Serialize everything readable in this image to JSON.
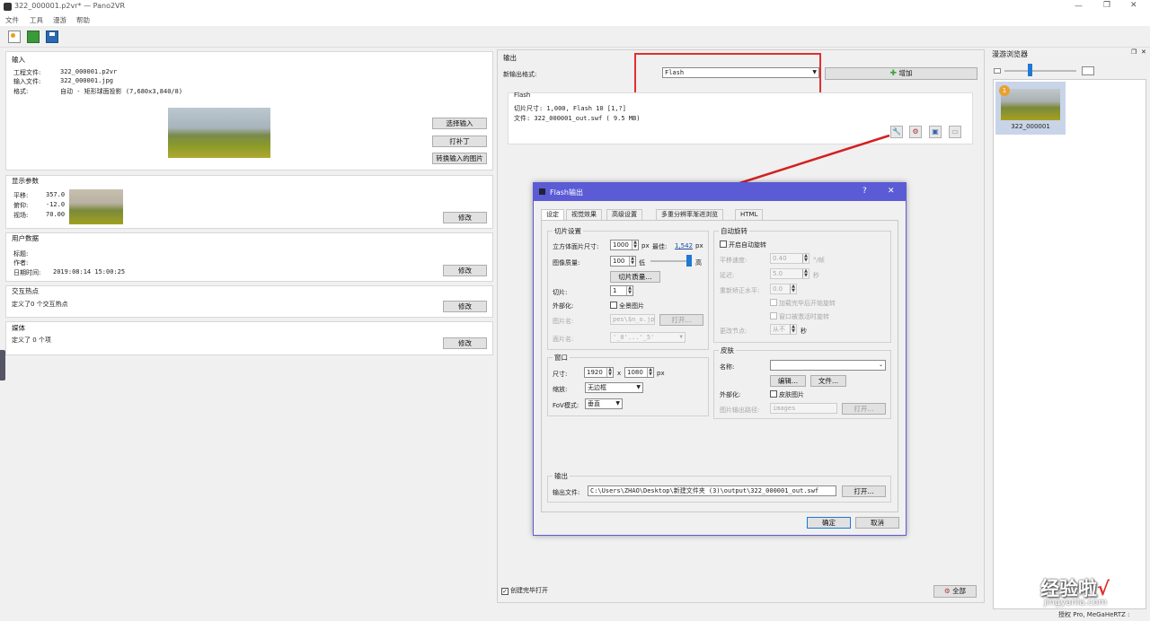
{
  "window": {
    "title": "322_000001.p2vr* — Pano2VR"
  },
  "menu": [
    "文件",
    "工具",
    "漫游",
    "帮助"
  ],
  "input": {
    "heading": "输入",
    "project_label": "工程文件:",
    "project_value": "322_000001.p2vr",
    "input_label": "输入文件:",
    "input_value": "322_000001.jpg",
    "format_label": "格式:",
    "format_value": "自动 - 矩形球面投影 (7,680x3,840/8)",
    "select_btn": "选择输入",
    "patch_btn": "打补丁",
    "convert_btn": "转换输入的图片"
  },
  "display": {
    "heading": "显示参数",
    "pan_label": "平移:",
    "pan_value": "357.0",
    "tilt_label": "俯仰:",
    "tilt_value": "-12.0",
    "fov_label": "视场:",
    "fov_value": "70.00",
    "modify_btn": "修改"
  },
  "userdata": {
    "heading": "用户数据",
    "title_label": "标题:",
    "author_label": "作者:",
    "date_label": "日期时间:",
    "date_value": "2019:08:14 15:00:25",
    "modify_btn": "修改"
  },
  "hotspots": {
    "heading": "交互热点",
    "text": "定义了0 个交互热点",
    "modify_btn": "修改"
  },
  "media": {
    "heading": "媒体",
    "text": "定义了 0 个项",
    "modify_btn": "修改"
  },
  "output": {
    "heading": "输出",
    "new_format_label": "新输出格式:",
    "format_value": "Flash",
    "add_btn": "增加",
    "flash_heading": "Flash",
    "tile_info": "切片尺寸: 1,000, Flash 10 [1,?]",
    "file_info": "文件: 322_000001_out.swf (      9.5 MB)",
    "create_open_label": "创建完毕打开",
    "all_btn": "全部"
  },
  "dialog": {
    "title": "Flash输出",
    "help": "?",
    "close": "✕",
    "tabs": [
      "设定",
      "视觉效果",
      "高级设置",
      "多重分辨率渐进浏览",
      "HTML"
    ],
    "tile_settings": {
      "heading": "切片设置",
      "cube_label": "立方体面片尺寸:",
      "cube_value": "1000",
      "px": "px",
      "best_label": "最佳:",
      "best_value": "1,542",
      "quality_label": "图像质量:",
      "quality_value": "100",
      "low": "低",
      "high": "高",
      "quality_btn": "切片质量...",
      "tiles_label": "切片:",
      "tiles_value": "1",
      "external_label": "外部化:",
      "panorama_image": "全景图片",
      "image_name_label": "图片名:",
      "image_name_value": "pes\\$n_o.jpg",
      "open_btn": "打开...",
      "face_name_label": "面片名:",
      "face_name_value": "'_0'...'_5'"
    },
    "window_group": {
      "heading": "窗口",
      "size_label": "尺寸:",
      "width": "1920",
      "x": "x",
      "height": "1080",
      "px": "px",
      "scale_label": "缩放:",
      "scale_value": "无边框",
      "fov_mode_label": "FoV模式:",
      "fov_mode_value": "垂直"
    },
    "autorotate": {
      "heading": "自动旋转",
      "enable": "开启自动旋转",
      "pan_speed_label": "平移速度:",
      "pan_speed_value": "0.40",
      "pan_speed_unit": "°/帧",
      "delay_label": "延迟:",
      "delay_value": "5.0",
      "delay_unit": "秒",
      "return_label": "重新矫正水平:",
      "return_value": "0.0",
      "start_after_load": "加载完毕后开始旋转",
      "rotate_on_activate": "窗口被激活时旋转",
      "change_node_label": "更改节点:",
      "change_node_value": "从不",
      "change_node_unit": "秒"
    },
    "skin": {
      "heading": "皮肤",
      "name_label": "名称:",
      "edit_btn": "编辑...",
      "file_btn": "文件...",
      "external_label": "外部化:",
      "skin_image": "皮肤图片",
      "path_label": "图片输出路径:",
      "path_value": "images",
      "open_btn": "打开..."
    },
    "output_group": {
      "heading": "输出",
      "file_label": "输出文件:",
      "file_value": "C:\\Users\\ZHAO\\Desktop\\新建文件夹 (3)\\output\\322_000001_out.swf",
      "open_btn": "打开..."
    },
    "ok_btn": "确定",
    "cancel_btn": "取消"
  },
  "tour": {
    "heading": "漫游浏览器",
    "node_label": "322_000001",
    "node_badge": "1"
  },
  "statusbar": {
    "text": "授权 Pro, MeGaHeRTZ :"
  },
  "watermark": {
    "brand": "经验啦",
    "check": "√",
    "url": "jingyanla.com"
  },
  "colors": {
    "dialog_title": "#5b5bd6",
    "highlight_red": "#e03030",
    "arrow_red": "#d42020",
    "add_green": "#3aa53a"
  }
}
